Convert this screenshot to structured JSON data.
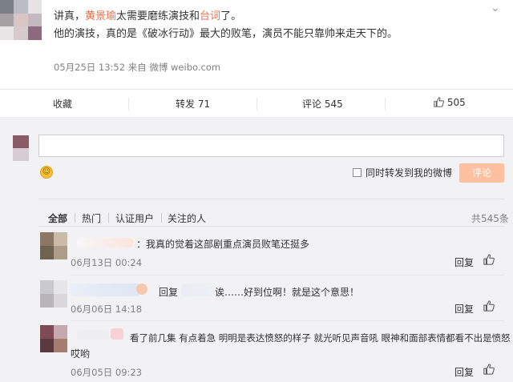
{
  "post": {
    "line1": {
      "prefix": "讲真，",
      "name": "黄景瑜",
      "middle": "太需要磨练演技和",
      "word": "台词",
      "suffix": "了。"
    },
    "line2": "他的演技，真的是《破冰行动》最大的败笔，演员不能只靠帅来走天下的。",
    "meta": "05月25日 13:52 来自 微博 weibo.com",
    "chevron_icon": "chevron-down-icon"
  },
  "actions": {
    "favorite": "收藏",
    "repost": "转发 71",
    "comment": "评论 545",
    "like": "505",
    "like_icon": "thumbs-up-icon"
  },
  "composer": {
    "textarea_value": "",
    "emoji_icon": "smiley-icon",
    "also_repost_label": "同时转发到我的微博",
    "submit_label": "评论",
    "submit_color": "#ffc09f"
  },
  "filters": {
    "tabs": [
      "全部",
      "热门",
      "认证用户",
      "关注的人"
    ],
    "active": "全部",
    "count": "共545条"
  },
  "comments": [
    {
      "text": "：我真的觉着这部剧重点演员败笔还挺多",
      "time": "06月13日 00:24",
      "reply": "回复"
    },
    {
      "text_a": "回复",
      "text_b": "诶……好到位啊！就是这个意思！",
      "time": "06月06日 14:18",
      "reply": "回复"
    },
    {
      "text_line1": "看了前几集 有点着急 明明是表达愤怒的样子 就光听见声音吼 眼神和面部表情都看不出是愤怒",
      "text_line2": "哎哟",
      "time": "06月05日 09:23",
      "reply": "回复"
    }
  ],
  "colors": {
    "highlight": "#eb7350",
    "meta": "#808080",
    "band": "#f2f2f5"
  }
}
